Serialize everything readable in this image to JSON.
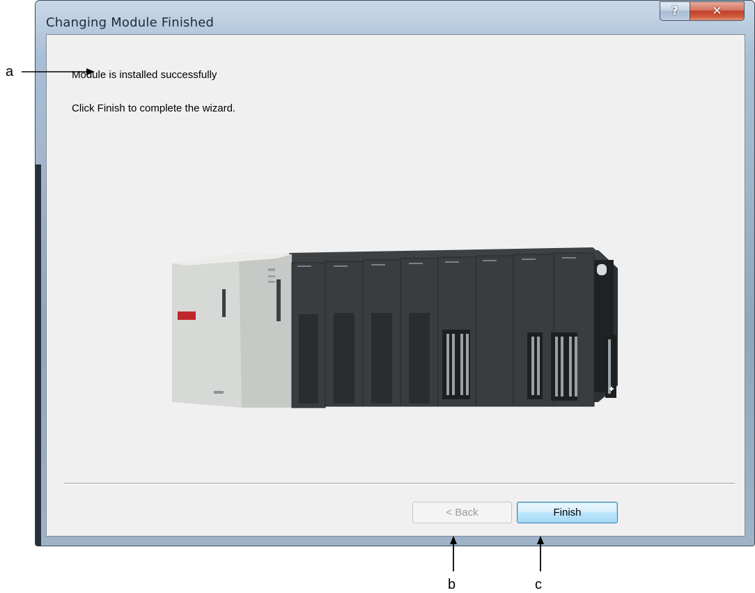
{
  "window": {
    "title": "Changing Module Finished",
    "help_glyph": "?",
    "close_glyph": "✕"
  },
  "content": {
    "message_primary": "Module is installed successfully",
    "message_secondary": "Click Finish to complete the wizard."
  },
  "buttons": {
    "back_label": "< Back",
    "back_enabled": false,
    "finish_label": "Finish"
  },
  "annotations": {
    "a": "a",
    "b": "b",
    "c": "c"
  },
  "icons": {
    "help": "help-icon",
    "close": "close-icon",
    "illustration": "plc-module-rack-image"
  },
  "colors": {
    "client_bg": "#f0f0f0",
    "finish_border": "#3c7fb1",
    "close_red": "#c0402a"
  }
}
